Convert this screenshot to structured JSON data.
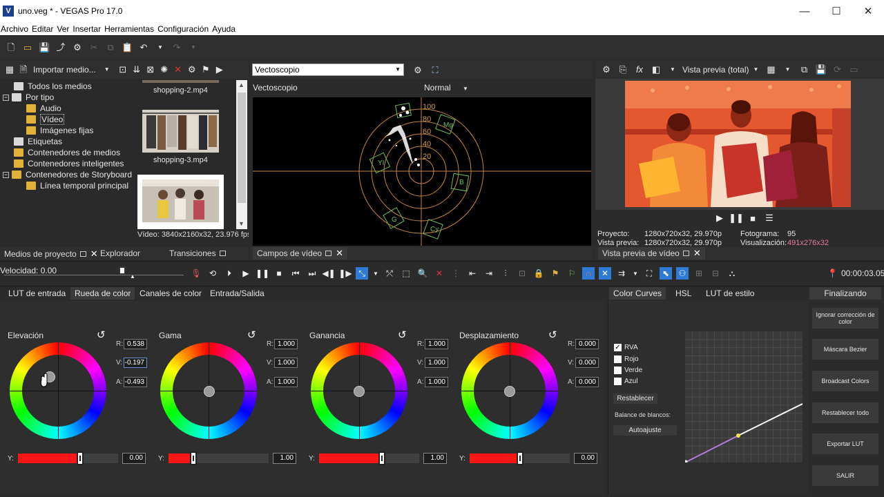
{
  "window": {
    "title": "uno.veg * - VEGAS Pro 17.0",
    "app_icon": "V",
    "minimize": "—",
    "maximize": "☐",
    "close": "✕"
  },
  "menu": [
    "Archivo",
    "Editar",
    "Ver",
    "Insertar",
    "Herramientas",
    "Configuración",
    "Ayuda"
  ],
  "media_panel": {
    "import_label": "Importar medio...",
    "tree": [
      {
        "label": "Todos los medios",
        "indent": 0
      },
      {
        "label": "Por tipo",
        "indent": 0
      },
      {
        "label": "Audio",
        "indent": 1
      },
      {
        "label": "Vídeo",
        "indent": 1
      },
      {
        "label": "Imágenes fijas",
        "indent": 1
      },
      {
        "label": "Etiquetas",
        "indent": 0
      },
      {
        "label": "Contenedores de medios",
        "indent": 0
      },
      {
        "label": "Contenedores inteligentes",
        "indent": 0
      },
      {
        "label": "Contenedores de Storyboard",
        "indent": 0
      },
      {
        "label": "Línea temporal principal",
        "indent": 1
      }
    ],
    "thumbs": [
      "shopping-2.mp4",
      "shopping-3.mp4"
    ],
    "status": "Vídeo: 3840x2160x32, 23.976 fps"
  },
  "left_tabs": {
    "project_media": "Medios de proyecto",
    "explorer": "Explorador",
    "transitions": "Transiciones",
    "close": "✕"
  },
  "scope": {
    "select_value": "Vectoscopio",
    "title": "Vectoscopio",
    "mode": "Normal",
    "rings": [
      "100",
      "80",
      "60",
      "40",
      "20"
    ],
    "targets": [
      "Mg",
      "YI",
      "B",
      "G",
      "Cy"
    ],
    "tab": "Campos de vídeo",
    "close": "✕"
  },
  "preview": {
    "mode_label": "Vista previa (total)",
    "proyecto_label": "Proyecto:",
    "proyecto_value": "1280x720x32, 29.970p",
    "vista_label": "Vista previa:",
    "vista_value": "1280x720x32, 29.970p",
    "fotograma_label": "Fotograma:",
    "fotograma_value": "95",
    "visualizacion_label": "Visualización:",
    "visualizacion_value": "491x276x32",
    "tab": "Vista previa de vídeo",
    "close": "✕"
  },
  "transport": {
    "speed": "Velocidad: 0.00",
    "timecode": "00:00:03.05"
  },
  "color_tabs": [
    "LUT de entrada",
    "Rueda de color",
    "Canales de color",
    "Entrada/Salida"
  ],
  "curve_tabs": [
    "Color Curves",
    "HSL",
    "LUT de estilo"
  ],
  "final_tab": "Finalizando",
  "wheels": [
    {
      "name": "Elevación",
      "r": "0.538",
      "v": "-0.197",
      "a": "-0.493",
      "y": "0.00",
      "y_level": 0.62
    },
    {
      "name": "Gama",
      "r": "1.000",
      "v": "1.000",
      "a": "1.000",
      "y": "1.00",
      "y_level": 0.25
    },
    {
      "name": "Ganancia",
      "r": "1.000",
      "v": "1.000",
      "a": "1.000",
      "y": "1.00",
      "y_level": 0.63
    },
    {
      "name": "Desplazamiento",
      "r": "0.000",
      "v": "0.000",
      "a": "0.000",
      "y": "0.00",
      "y_level": 0.5
    }
  ],
  "rva_labels": {
    "r": "R:",
    "v": "V:",
    "a": "A:",
    "y": "Y:"
  },
  "curves": {
    "checks": [
      {
        "label": "RVA",
        "checked": true
      },
      {
        "label": "Rojo",
        "checked": false
      },
      {
        "label": "Verde",
        "checked": false
      },
      {
        "label": "Azul",
        "checked": false
      }
    ],
    "reset": "Restablecer",
    "white_balance": "Balance de blancos:",
    "auto": "Autoajuste"
  },
  "side_buttons": [
    "Ignorar corrección de color",
    "Máscara Bezier",
    "Broadcast Colors",
    "Restablecer todo",
    "Exportar LUT",
    "SALIR"
  ]
}
